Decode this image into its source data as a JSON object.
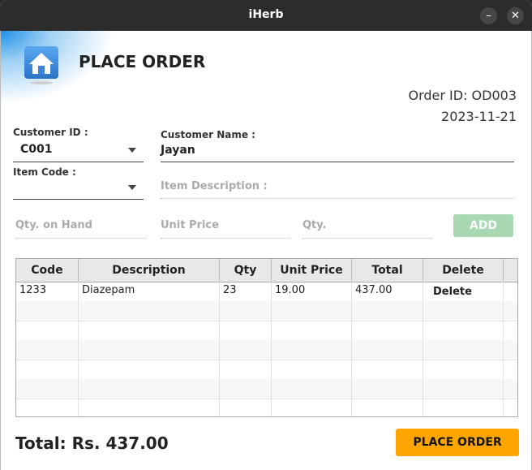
{
  "window": {
    "title": "iHerb",
    "minimize_icon": "minus-icon",
    "close_icon": "close-icon"
  },
  "header": {
    "title": "PLACE ORDER",
    "icon": "home-icon",
    "order_id": "Order ID: OD003",
    "date": "2023-11-21"
  },
  "form": {
    "customer_id_label": "Customer ID :",
    "customer_id_value": "C001",
    "customer_name_label": "Customer Name :",
    "customer_name_value": "Jayan",
    "item_code_label": "Item Code :",
    "item_code_value": "",
    "item_description_placeholder": "Item Description :",
    "qty_on_hand_placeholder": "Qty. on Hand",
    "unit_price_placeholder": "Unit Price",
    "qty_placeholder": "Qty.",
    "add_label": "ADD"
  },
  "table": {
    "columns": [
      "Code",
      "Description",
      "Qty",
      "Unit Price",
      "Total",
      "Delete"
    ],
    "rows": [
      [
        "1233",
        "Diazepam",
        "23",
        "19.00",
        "437.00",
        "Delete"
      ]
    ]
  },
  "footer": {
    "total": "Total: Rs. 437.00",
    "place_order_label": "PLACE ORDER"
  },
  "colors": {
    "add_button": "#a8d8b2",
    "place_order_button": "#ffa500",
    "titlebar": "#2c2c2c"
  }
}
